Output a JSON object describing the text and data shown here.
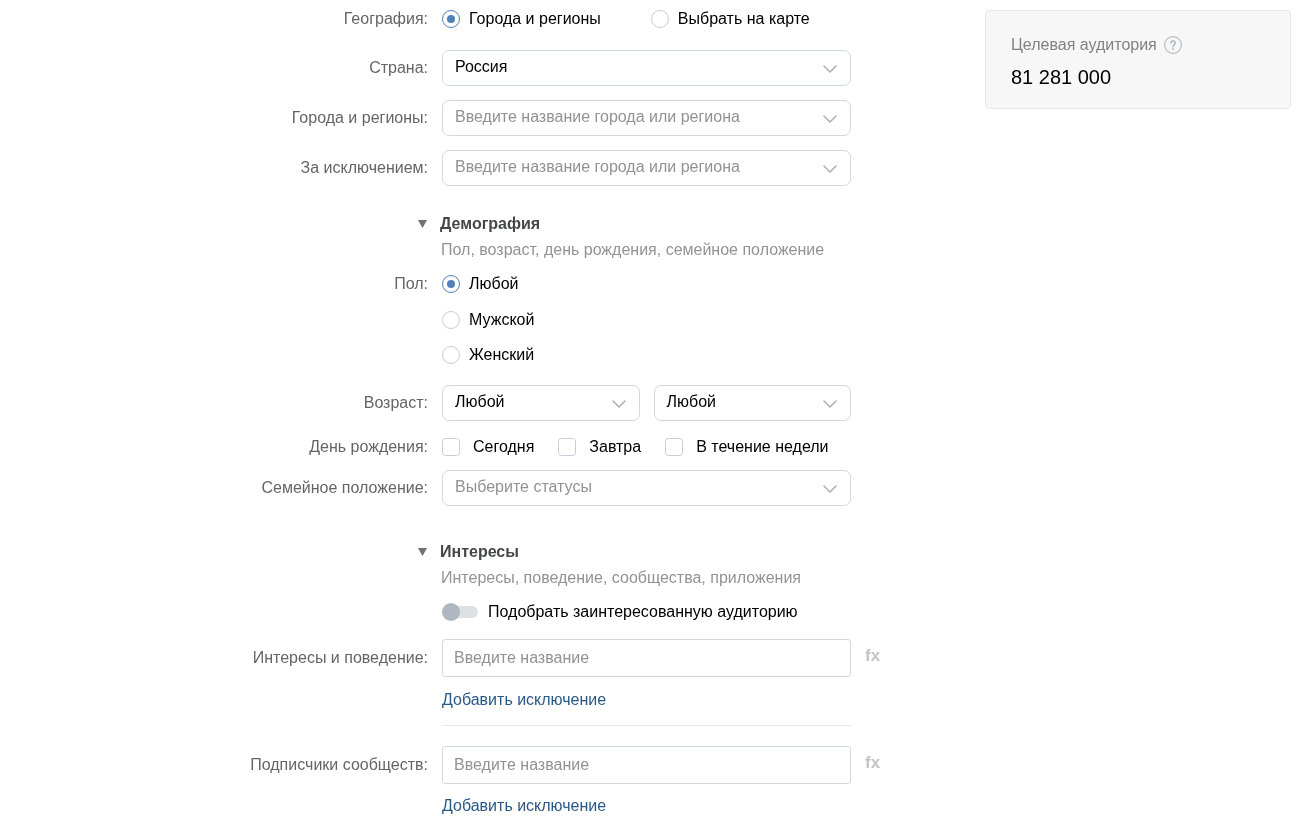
{
  "geography": {
    "label": "География:",
    "options": [
      {
        "label": "Города и регионы",
        "selected": true
      },
      {
        "label": "Выбрать на карте",
        "selected": false
      }
    ]
  },
  "location_fields": [
    {
      "label": "Страна:",
      "value": "Россия"
    },
    {
      "label": "Города и регионы:",
      "placeholder": "Введите название города или региона"
    },
    {
      "label": "За исключением:",
      "placeholder": "Введите название города или региона"
    }
  ],
  "demography": {
    "title": "Демография",
    "subtitle": "Пол, возраст, день рождения, семейное положение",
    "expanded": true,
    "gender": {
      "label": "Пол:",
      "options": [
        {
          "label": "Любой",
          "selected": true
        },
        {
          "label": "Мужской",
          "selected": false
        },
        {
          "label": "Женский",
          "selected": false
        }
      ]
    },
    "age": {
      "label": "Возраст:",
      "from": "Любой",
      "to": "Любой"
    },
    "birthday": {
      "label": "День рождения:",
      "options": [
        {
          "label": "Сегодня",
          "checked": false
        },
        {
          "label": "Завтра",
          "checked": false
        },
        {
          "label": "В течение недели",
          "checked": false
        }
      ]
    },
    "marital_status": {
      "label": "Семейное положение:",
      "placeholder": "Выберите статусы"
    }
  },
  "interests": {
    "title": "Интересы",
    "subtitle": "Интересы, поведение, сообщества, приложения",
    "expanded": true,
    "toggle": {
      "label": "Подобрать заинтересованную аудиторию",
      "on": false
    },
    "fields": [
      {
        "label": "Интересы и поведение:",
        "placeholder": "Введите название",
        "formula": "fx",
        "link": "Добавить исключение"
      },
      {
        "label": "Подписчики сообществ:",
        "placeholder": "Введите название",
        "formula": "fx",
        "link": "Добавить исключение"
      }
    ]
  },
  "audience": {
    "title": "Целевая аудитория",
    "value": "81 281 000"
  }
}
